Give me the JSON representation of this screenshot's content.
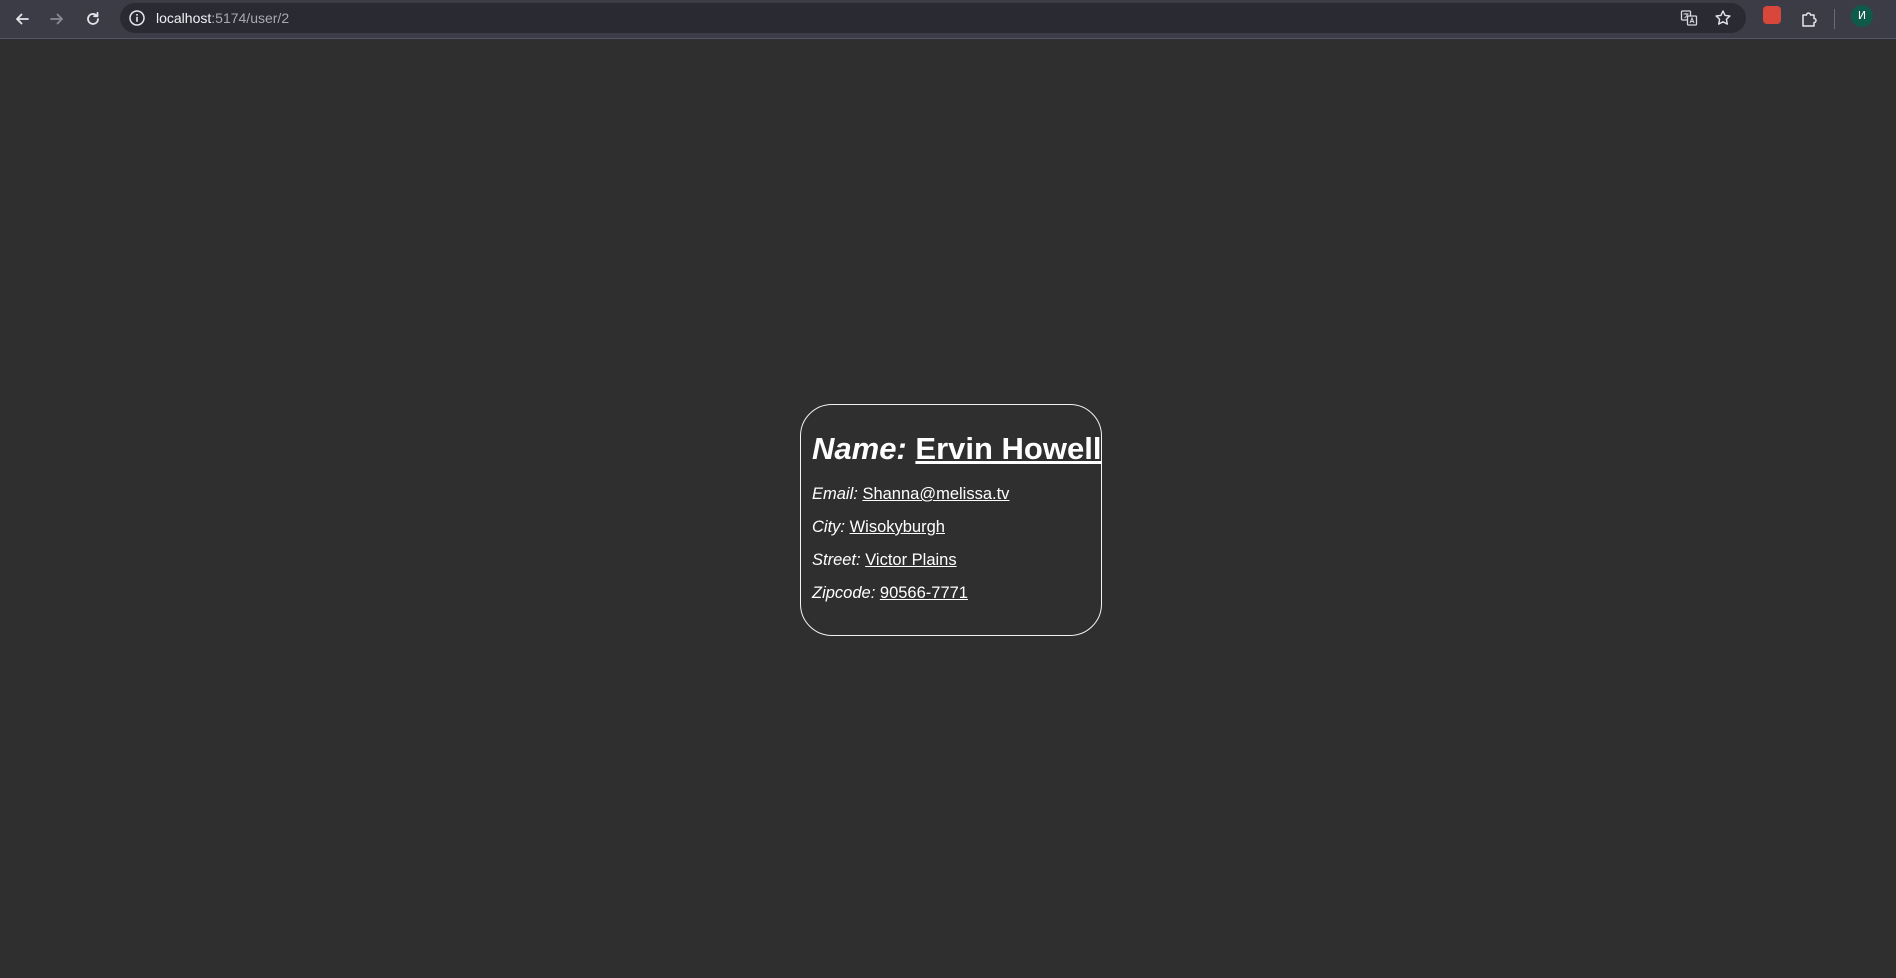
{
  "browser": {
    "url_host": "localhost",
    "url_path": ":5174/user/2",
    "avatar_letter": "И",
    "icons": {
      "back": "back-arrow-icon",
      "forward": "forward-arrow-icon",
      "reload": "reload-icon",
      "site_info": "info-icon",
      "translate": "translate-icon",
      "bookmark": "star-icon",
      "extension": "extension-icon",
      "extensions_menu": "puzzle-icon"
    }
  },
  "user": {
    "name_label": "Name:",
    "name": "Ervin Howell",
    "email_label": "Email:",
    "email": "Shanna@melissa.tv",
    "city_label": "City:",
    "city": "Wisokyburgh",
    "street_label": "Street:",
    "street": "Victor Plains",
    "zipcode_label": "Zipcode:",
    "zipcode": "90566-7771"
  },
  "colors": {
    "page_background": "#2f2f2f",
    "toolbar_background": "#3c3c46",
    "text": "#ffffff",
    "card_border": "#f2f2f2",
    "avatar": "#0f5a4a"
  }
}
